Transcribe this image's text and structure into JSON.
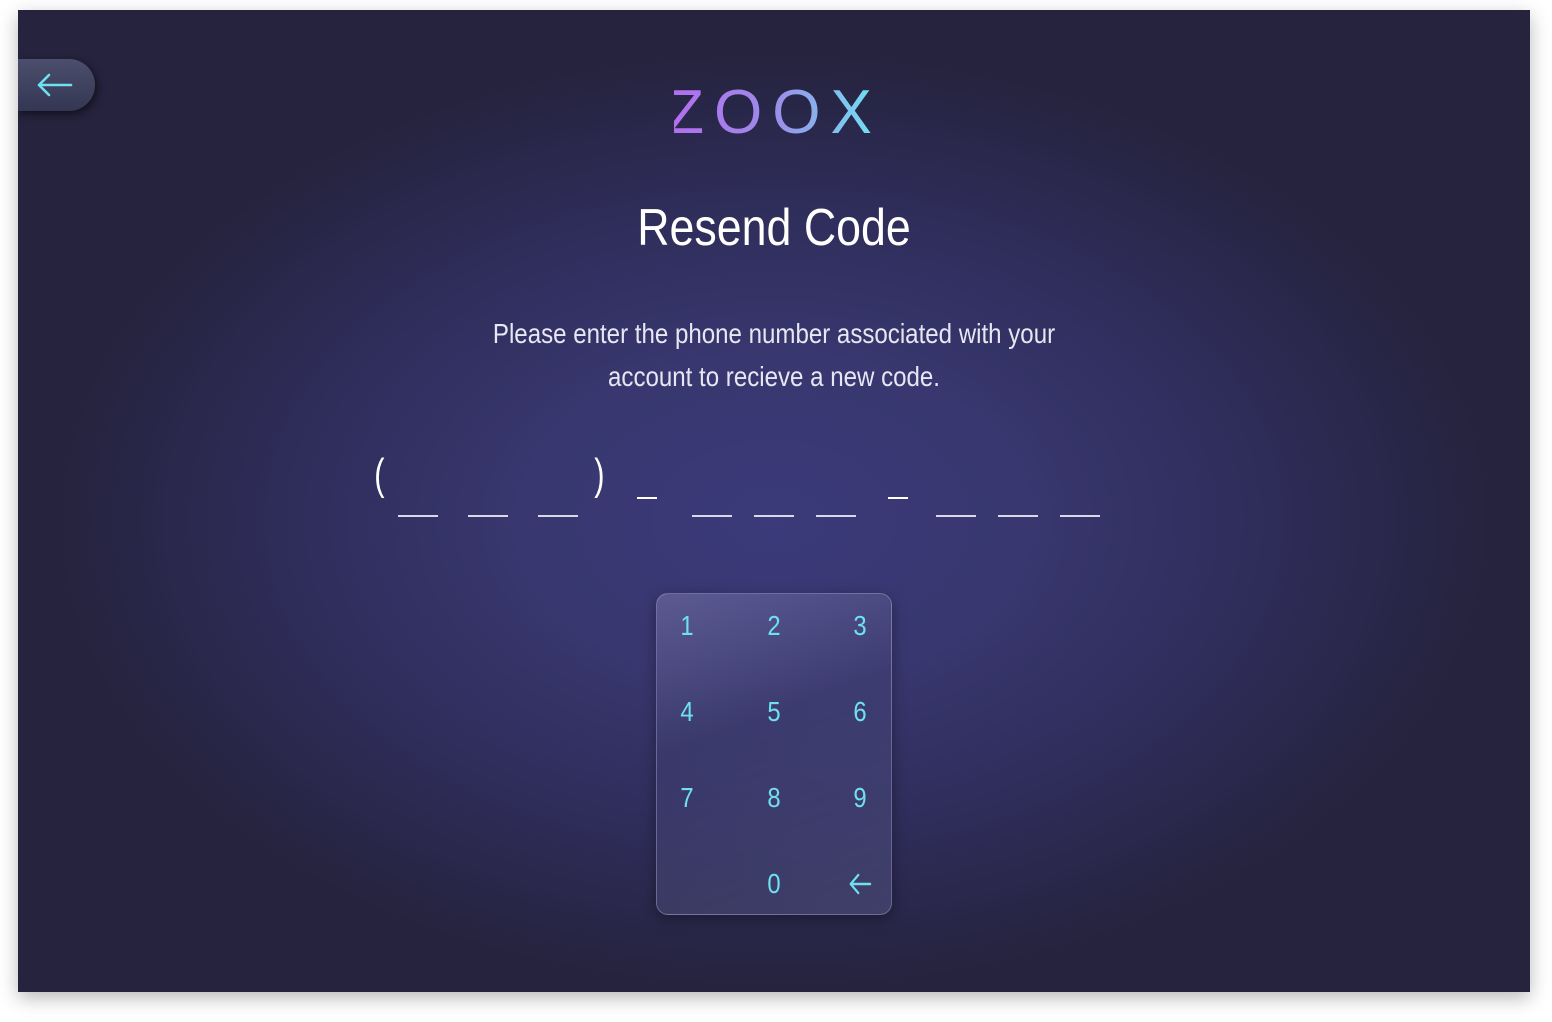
{
  "logo": {
    "text": "ZOOX"
  },
  "title": "Resend Code",
  "subtitle": "Please enter the phone number associated with your account to recieve a new code.",
  "phone": {
    "open_paren": "(",
    "close_paren": ")",
    "digits": [
      "",
      "",
      "",
      "",
      "",
      "",
      "",
      "",
      "",
      ""
    ]
  },
  "keypad": {
    "keys": [
      "1",
      "2",
      "3",
      "4",
      "5",
      "6",
      "7",
      "8",
      "9",
      "0"
    ]
  },
  "icons": {
    "back": "arrow-left-icon",
    "keypad_delete": "arrow-left-icon"
  },
  "colors": {
    "accent": "#6fe0f0",
    "logo_gradient_start": "#b46cf0",
    "logo_gradient_end": "#6ee6f4",
    "background_center": "#3b3a7a",
    "background_edge": "#25233d"
  }
}
